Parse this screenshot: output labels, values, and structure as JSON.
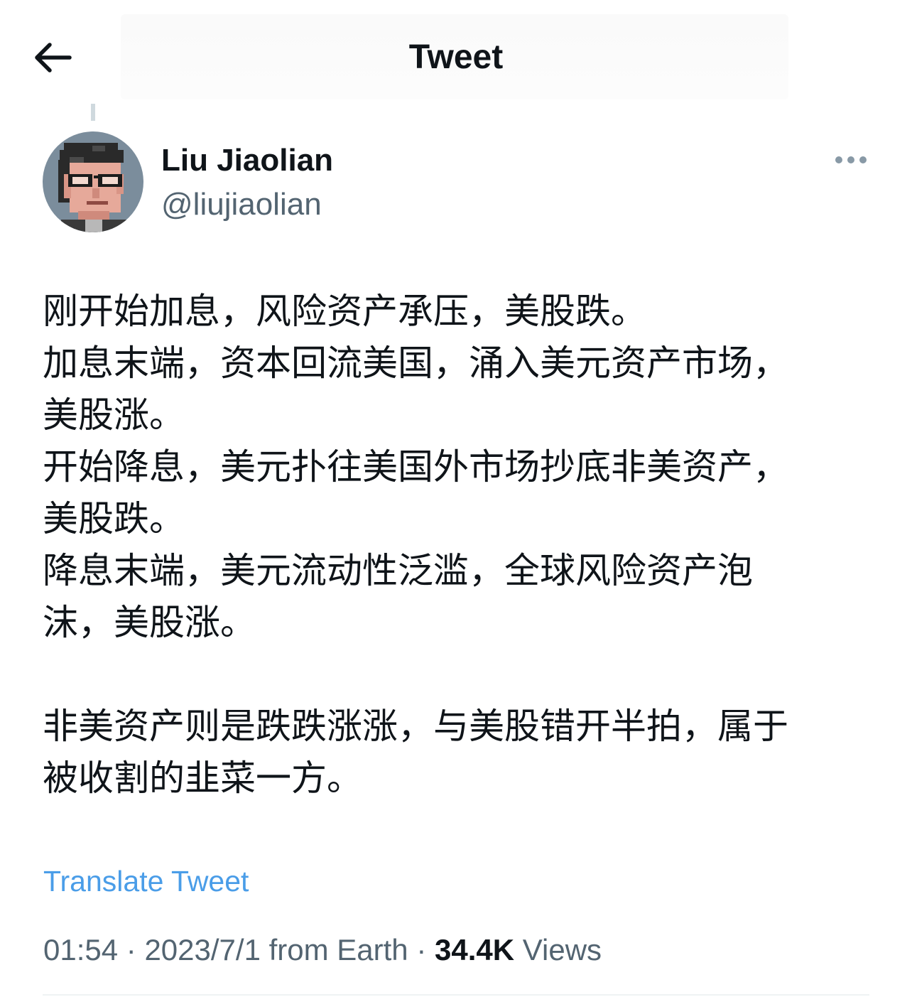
{
  "header": {
    "title": "Tweet",
    "back_icon": "arrow-left-icon"
  },
  "author": {
    "display_name": "Liu Jiaolian",
    "handle": "@liujiaolian",
    "avatar_icon": "pixel-art-portrait-avatar"
  },
  "more_icon": "more-horizontal-icon",
  "tweet": {
    "text": "刚开始加息，风险资产承压，美股跌。\n加息末端，资本回流美国，涌入美元资产市场，\n美股涨。\n开始降息，美元扑往美国外市场抄底非美资产，\n美股跌。\n降息末端，美元流动性泛滥，全球风险资产泡\n沫，美股涨。\n\n非美资产则是跌跌涨涨，与美股错开半拍，属于\n被收割的韭菜一方。"
  },
  "translate_label": "Translate Tweet",
  "meta": {
    "time": "01:54",
    "separator": " · ",
    "date": "2023/7/1",
    "source": "from Earth",
    "views_count": "34.4K",
    "views_label": "Views"
  },
  "colors": {
    "text_primary": "#0f1419",
    "text_secondary": "#536471",
    "link": "#4a9de8",
    "divider": "#eff3f4"
  }
}
